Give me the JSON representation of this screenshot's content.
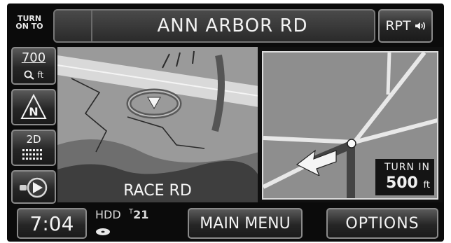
{
  "header": {
    "turn_label_line1": "TURN",
    "turn_label_line2": "ON TO",
    "street_name": "ANN ARBOR RD",
    "repeat_label": "RPT",
    "repeat_icon": "speaker-icon"
  },
  "sidebar": {
    "zoom_value": "700",
    "zoom_unit": "ft",
    "zoom_icon": "magnifier-icon",
    "north_letter": "N",
    "north_icon": "north-up-icon",
    "view_label": "2D",
    "view_icon": "grid-icon",
    "locate_icon": "current-position-icon"
  },
  "map": {
    "cross_street": "RACE RD",
    "vehicle_icon": "vehicle-position-icon"
  },
  "turn_preview": {
    "turn_in_label": "TURN IN",
    "distance_value": "500",
    "distance_unit": "ft",
    "arrow_icon": "turn-arrow-icon"
  },
  "footer": {
    "clock": "7:04",
    "source_label": "HDD",
    "track_prefix": "T",
    "track_number": "21",
    "disc_icon": "disc-icon",
    "main_menu_label": "MAIN MENU",
    "options_label": "OPTIONS"
  }
}
